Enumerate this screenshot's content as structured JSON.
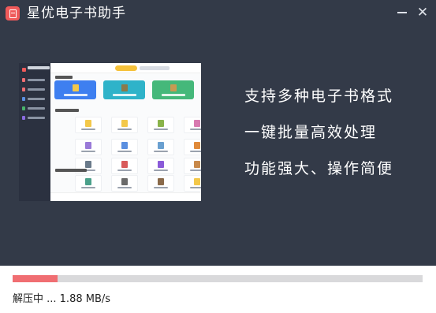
{
  "window": {
    "title": "星优电子书助手",
    "minimize_glyph": "",
    "close_glyph": "✕"
  },
  "slogans": [
    "支持多种电子书格式",
    "一键批量高效处理",
    "功能强大、操作简便"
  ],
  "progress": {
    "fraction": 0.11,
    "status_text": "解压中 ... 1.88 MB/s"
  },
  "colors": {
    "panel_bg": "#333a48",
    "accent": "#f06e72",
    "track": "#d9d9db",
    "logo": "#ef5a5a"
  },
  "icons": {
    "logo": "book-logo-icon",
    "minimize": "minimize-icon",
    "close": "close-icon"
  }
}
